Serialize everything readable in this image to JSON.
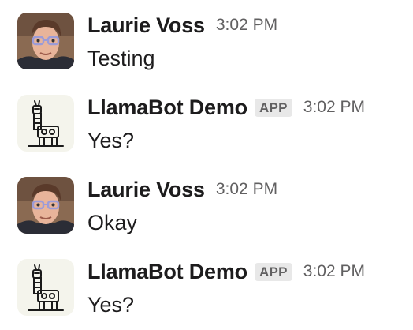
{
  "messages": [
    {
      "author": "Laurie Voss",
      "badge": "",
      "time": "3:02 PM",
      "text": "Testing",
      "avatar": "person-avatar"
    },
    {
      "author": "LlamaBot Demo",
      "badge": "APP",
      "time": "3:02 PM",
      "text": "Yes?",
      "avatar": "llama-avatar"
    },
    {
      "author": "Laurie Voss",
      "badge": "",
      "time": "3:02 PM",
      "text": "Okay",
      "avatar": "person-avatar"
    },
    {
      "author": "LlamaBot Demo",
      "badge": "APP",
      "time": "3:02 PM",
      "text": "Yes?",
      "avatar": "llama-avatar"
    }
  ],
  "colors": {
    "text": "#1d1c1d",
    "muted": "#616061",
    "badge_bg": "#e8e8e8"
  }
}
